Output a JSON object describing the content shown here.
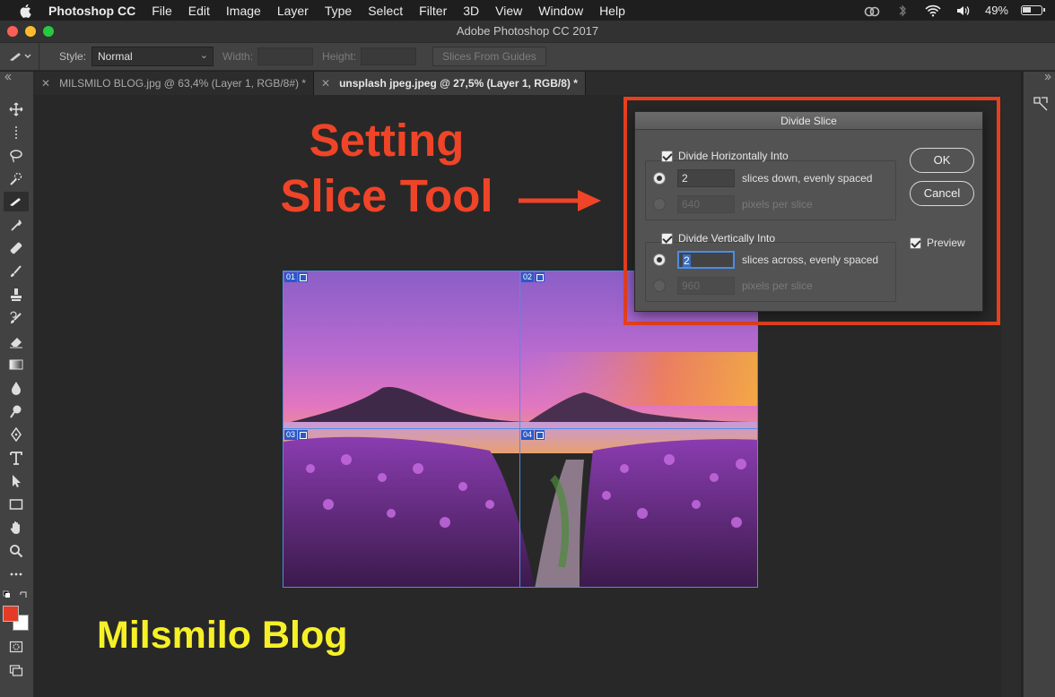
{
  "menubar": {
    "app": "Photoshop CC",
    "items": [
      "File",
      "Edit",
      "Image",
      "Layer",
      "Type",
      "Select",
      "Filter",
      "3D",
      "View",
      "Window",
      "Help"
    ],
    "battery": "49%"
  },
  "window": {
    "title": "Adobe Photoshop CC 2017"
  },
  "options": {
    "style_label": "Style:",
    "style_value": "Normal",
    "width_label": "Width:",
    "height_label": "Height:",
    "slices_from_guides": "Slices From Guides"
  },
  "tabs": [
    {
      "label": "MILSMILO BLOG.jpg @ 63,4% (Layer 1, RGB/8#) *",
      "active": false
    },
    {
      "label": "unsplash jpeg.jpeg @ 27,5% (Layer 1, RGB/8) *",
      "active": true
    }
  ],
  "overlay": {
    "headline_line1": "Setting",
    "headline_line2": "Slice Tool",
    "brand": "Milsmilo Blog",
    "accent_color": "#ef4428",
    "brand_color": "#f6f028"
  },
  "slices": [
    "01",
    "02",
    "03",
    "04"
  ],
  "dialog": {
    "title": "Divide Slice",
    "horizontal_label": "Divide Horizontally Into",
    "h_slices_value": "2",
    "h_slices_text": "slices down, evenly spaced",
    "h_pixels_value": "640",
    "h_pixels_text": "pixels per slice",
    "vertical_label": "Divide Vertically Into",
    "v_slices_value": "2",
    "v_slices_text": "slices across, evenly spaced",
    "v_pixels_value": "960",
    "v_pixels_text": "pixels per slice",
    "ok": "OK",
    "cancel": "Cancel",
    "preview": "Preview"
  }
}
